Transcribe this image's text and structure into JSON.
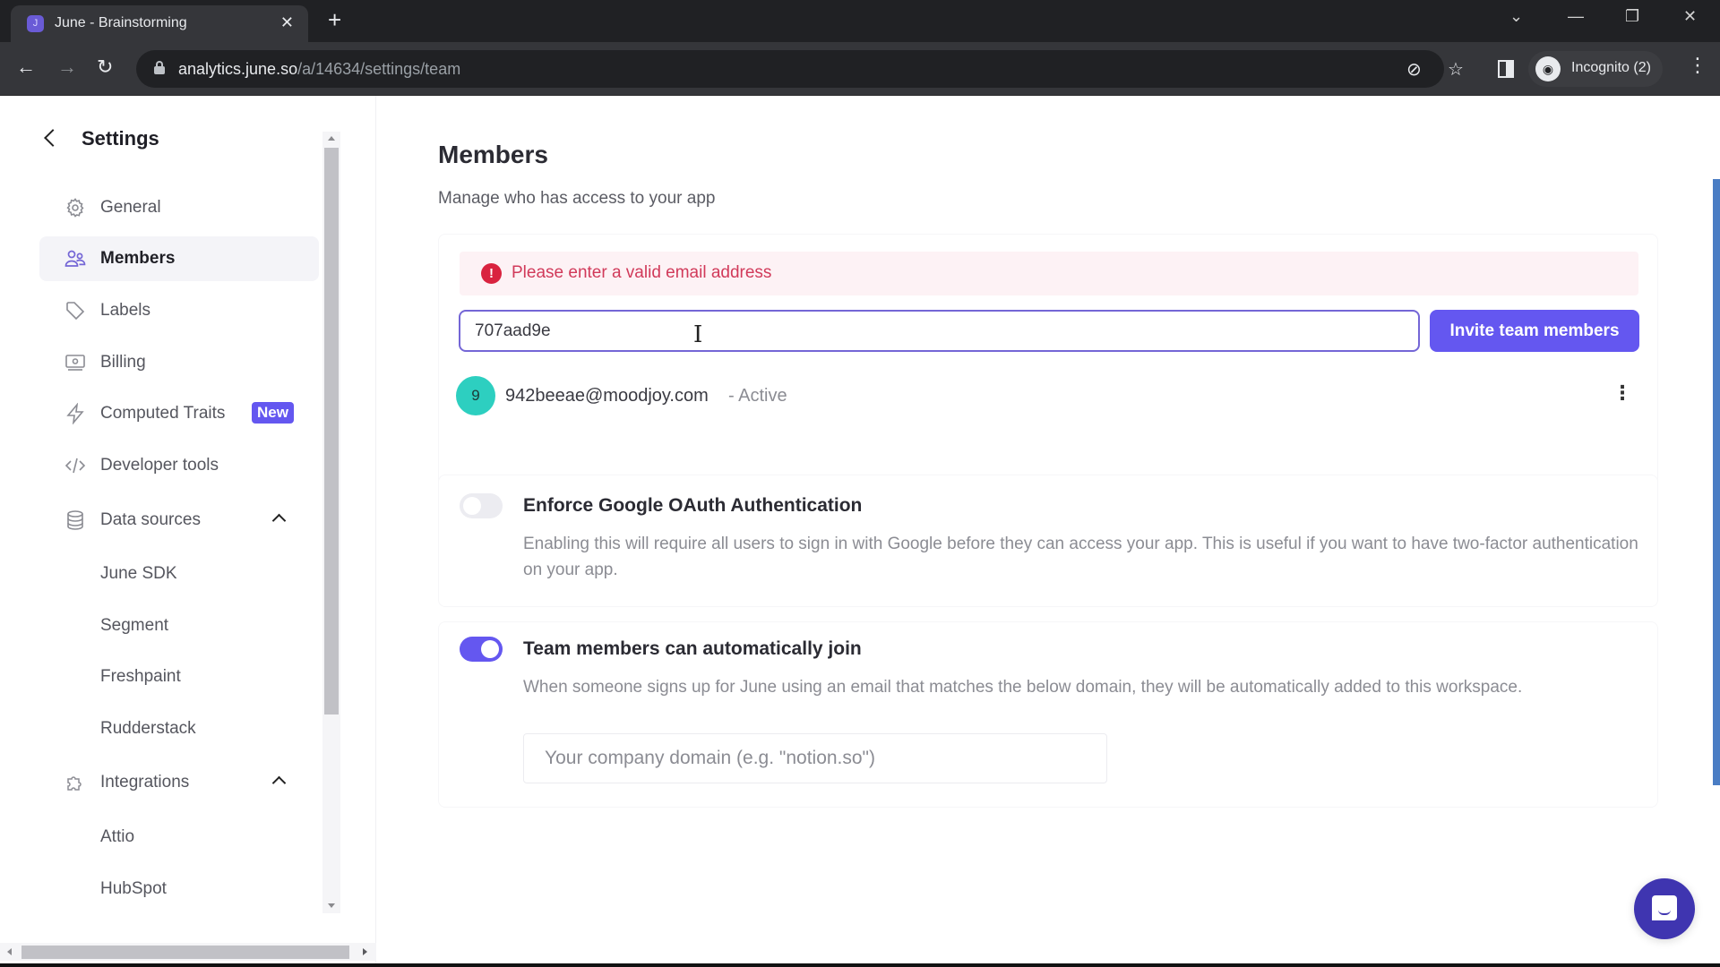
{
  "browser": {
    "tab_title": "June - Brainstorming",
    "tab_favicon": "june-logo",
    "url_host": "analytics.june.so",
    "url_path": "/a/14634/settings/team",
    "profile_label": "Incognito (2)",
    "icons": {
      "back": "←",
      "forward": "→",
      "reload": "↻",
      "new_tab": "+",
      "close_tab": "✕",
      "tab_search": "⌄",
      "minimize": "—",
      "restore": "❐",
      "close_window": "✕",
      "eye_off": "⊘",
      "star": "☆",
      "menu": "⋮",
      "incognito": "🕶"
    }
  },
  "sidebar": {
    "title": "Settings",
    "items": [
      {
        "label": "General",
        "icon": "gear-icon",
        "active": false
      },
      {
        "label": "Members",
        "icon": "users-icon",
        "active": true
      },
      {
        "label": "Labels",
        "icon": "tag-icon",
        "active": false
      },
      {
        "label": "Billing",
        "icon": "billing-icon",
        "active": false
      },
      {
        "label": "Computed Traits",
        "icon": "bolt-icon",
        "active": false,
        "badge": "New"
      },
      {
        "label": "Developer tools",
        "icon": "code-icon",
        "active": false
      },
      {
        "label": "Data sources",
        "icon": "database-icon",
        "expanded": true
      },
      {
        "label": "June SDK"
      },
      {
        "label": "Segment"
      },
      {
        "label": "Freshpaint"
      },
      {
        "label": "Rudderstack"
      },
      {
        "label": "Integrations",
        "icon": "puzzle-icon",
        "expanded": true
      },
      {
        "label": "Attio"
      },
      {
        "label": "HubSpot"
      }
    ]
  },
  "main": {
    "title": "Members",
    "subtitle": "Manage who has access to your app",
    "error_message": "Please enter a valid email address",
    "error_icon": "!",
    "invite_input_value": "707aad9e",
    "invite_button": "Invite team members",
    "members": [
      {
        "initial": "9",
        "email": "942beeae@moodjoy.com",
        "status": "- Active",
        "avatar_color": "#2dcfc0"
      }
    ],
    "row_menu_icon": "⋮",
    "google_oauth": {
      "title": "Enforce Google OAuth Authentication",
      "description": "Enabling this will require all users to sign in with Google before they can access your app. This is useful if you want to have two-factor authentication on your app.",
      "enabled": false
    },
    "auto_join": {
      "title": "Team members can automatically join",
      "description": "When someone signs up for June using an email that matches the below domain, they will be automatically added to this workspace.",
      "enabled": true,
      "domain_value": "",
      "domain_placeholder": "Your company domain (e.g. \"notion.so\")"
    }
  },
  "colors": {
    "accent": "#6457f0",
    "error_text": "#d13a5a",
    "error_bg": "#fdf2f5",
    "chat_bubble": "#3f35b0"
  }
}
